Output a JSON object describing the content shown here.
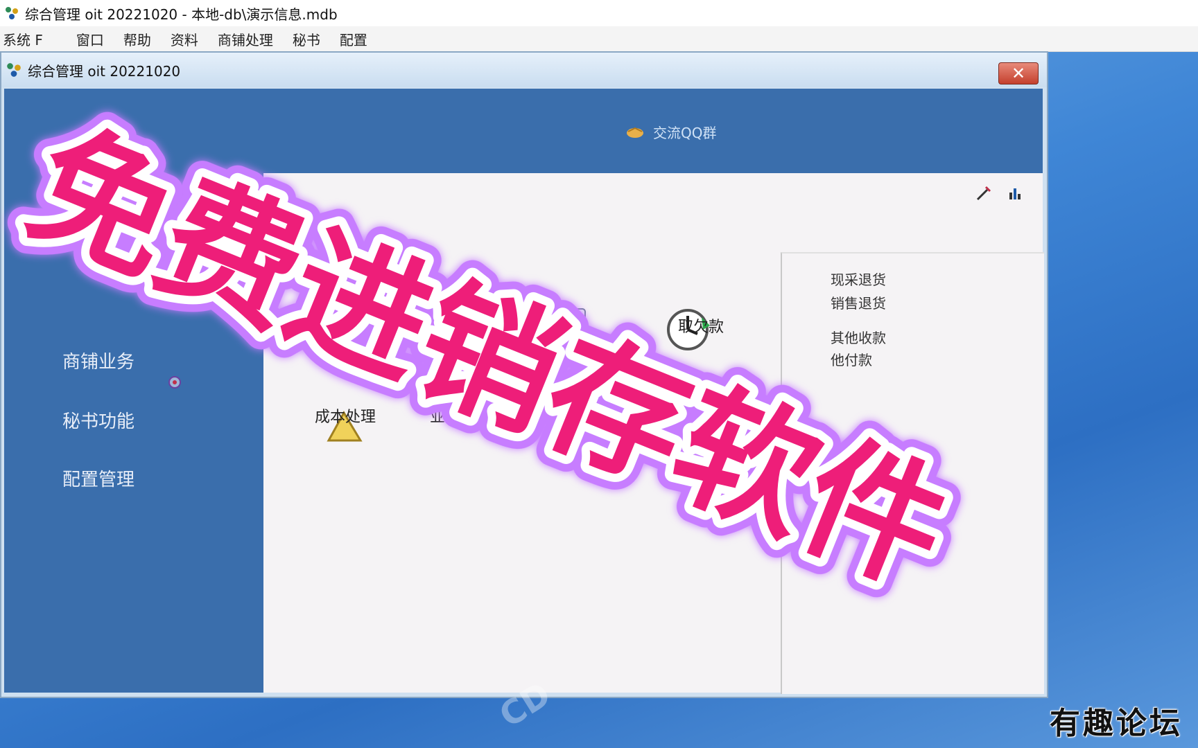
{
  "app": {
    "title": "综合管理 oit 20221020 - 本地-db\\演示信息.mdb",
    "menu": [
      "系统 F",
      "窗口",
      "帮助",
      "资料",
      "商铺处理",
      "秘书",
      "配置"
    ]
  },
  "inner_window": {
    "title": "综合管理 oit 20221020",
    "close_symbol": "✕"
  },
  "banner": {
    "qq_label": "交流QQ群"
  },
  "nav": {
    "items": [
      "商铺业务",
      "秘书功能",
      "配置管理"
    ]
  },
  "main": {
    "func_labels": [
      "成本处理",
      "业务",
      "取欠款"
    ]
  },
  "right_panel": {
    "items": [
      "现采退货",
      "销售退货",
      "其他收款",
      "他付款"
    ]
  },
  "overlay": {
    "headline": "免费进销存软件",
    "fill_color": "#ee1e79",
    "outline_color": "#ffffff",
    "glow_color": "#c77dff"
  },
  "watermark": "有趣论坛"
}
